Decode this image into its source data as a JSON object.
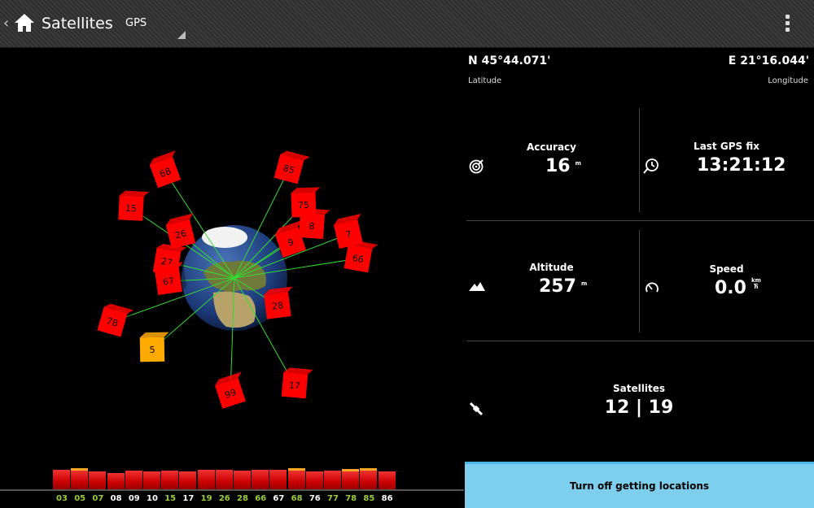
{
  "actionbar": {
    "title": "Satellites",
    "mode": "GPS"
  },
  "position": {
    "latitude": "N 45°44.071'",
    "latitude_label": "Latitude",
    "longitude": "E 21°16.044'",
    "longitude_label": "Longitude"
  },
  "stats": {
    "accuracy_label": "Accuracy",
    "accuracy_value": "16",
    "accuracy_unit": "m",
    "lastfix_label": "Last GPS fix",
    "lastfix_value": "13:21:12",
    "altitude_label": "Altitude",
    "altitude_value": "257",
    "altitude_unit": "m",
    "speed_label": "Speed",
    "speed_value": "0.0",
    "speed_unit_top": "km",
    "speed_unit_bottom": "h",
    "satellites_label": "Satellites",
    "satellites_value": "12 | 19"
  },
  "snr": [
    {
      "id": "03",
      "level": 0.5,
      "used": true
    },
    {
      "id": "05",
      "level": 0.55,
      "used": true
    },
    {
      "id": "07",
      "level": 0.45,
      "used": true
    },
    {
      "id": "08",
      "level": 0.42,
      "used": false
    },
    {
      "id": "09",
      "level": 0.47,
      "used": false
    },
    {
      "id": "10",
      "level": 0.45,
      "used": false
    },
    {
      "id": "15",
      "level": 0.47,
      "used": true
    },
    {
      "id": "17",
      "level": 0.45,
      "used": false
    },
    {
      "id": "19",
      "level": 0.5,
      "used": true
    },
    {
      "id": "26",
      "level": 0.5,
      "used": true
    },
    {
      "id": "28",
      "level": 0.47,
      "used": true
    },
    {
      "id": "66",
      "level": 0.5,
      "used": true
    },
    {
      "id": "67",
      "level": 0.5,
      "used": false
    },
    {
      "id": "68",
      "level": 0.55,
      "used": true
    },
    {
      "id": "76",
      "level": 0.45,
      "used": false
    },
    {
      "id": "77",
      "level": 0.48,
      "used": true
    },
    {
      "id": "78",
      "level": 0.52,
      "used": true
    },
    {
      "id": "85",
      "level": 0.55,
      "used": true
    },
    {
      "id": "86",
      "level": 0.45,
      "used": false
    }
  ],
  "satellites_3d": [
    {
      "id": "68",
      "color": "#ff0000"
    },
    {
      "id": "15",
      "color": "#ff0000"
    },
    {
      "id": "26",
      "color": "#ff0000"
    },
    {
      "id": "27",
      "color": "#ff0000"
    },
    {
      "id": "67",
      "color": "#ff0000"
    },
    {
      "id": "85",
      "color": "#ff0000"
    },
    {
      "id": "75",
      "color": "#ff0000"
    },
    {
      "id": "9",
      "color": "#ff0000"
    },
    {
      "id": "8",
      "color": "#ff0000"
    },
    {
      "id": "7",
      "color": "#ff0000"
    },
    {
      "id": "66",
      "color": "#ff0000"
    },
    {
      "id": "28",
      "color": "#ff0000"
    },
    {
      "id": "78",
      "color": "#ff0000"
    },
    {
      "id": "5",
      "color": "#ffaa00"
    },
    {
      "id": "99",
      "color": "#ff0000"
    },
    {
      "id": "17",
      "color": "#ff0000"
    }
  ],
  "turnoff_label": "Turn off getting locations",
  "colors": {
    "accent": "#7ecfee",
    "used_sat": "#9ccc3c",
    "satellite": "#ff0000",
    "satellite_unused": "#ffaa00"
  }
}
